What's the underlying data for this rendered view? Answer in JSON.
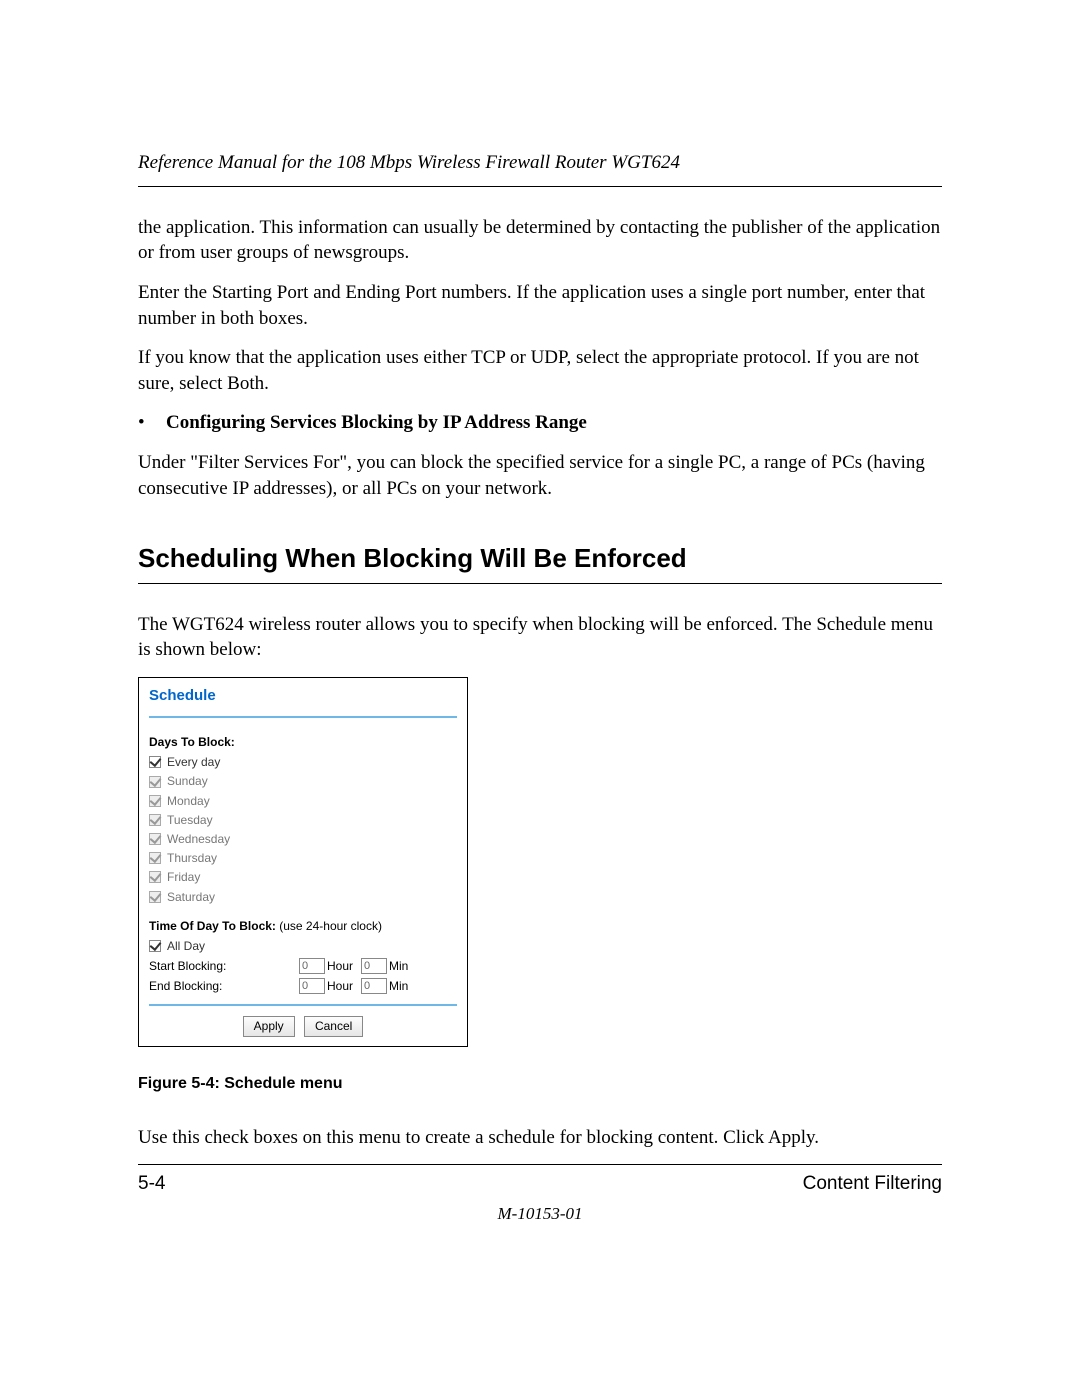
{
  "header": {
    "title": "Reference Manual for the 108 Mbps Wireless Firewall Router WGT624"
  },
  "paragraphs": {
    "p1": "the application. This information can usually be determined by contacting the publisher of the application or from user groups of newsgroups.",
    "p2": "Enter the Starting Port and Ending Port numbers. If the application uses a single port number, enter that number in both boxes.",
    "p3": "If you know that the application uses either TCP or UDP, select the appropriate protocol. If you are not sure, select Both.",
    "bullet_text": "Configuring Services Blocking by IP Address Range",
    "p4": "Under \"Filter Services For\", you can block the specified service for a single PC, a range of PCs (having consecutive IP addresses), or all PCs on your network.",
    "p5": "The WGT624 wireless router allows you to specify when blocking will be enforced. The Schedule menu is shown below:",
    "p6": "Use this check boxes on this menu to create a schedule for blocking content. Click Apply."
  },
  "section_heading": "Scheduling When Blocking Will Be Enforced",
  "schedule": {
    "title": "Schedule",
    "days_label": "Days To Block:",
    "days": [
      {
        "label": "Every day",
        "checked": true,
        "enabled": true
      },
      {
        "label": "Sunday",
        "checked": true,
        "enabled": false
      },
      {
        "label": "Monday",
        "checked": true,
        "enabled": false
      },
      {
        "label": "Tuesday",
        "checked": true,
        "enabled": false
      },
      {
        "label": "Wednesday",
        "checked": true,
        "enabled": false
      },
      {
        "label": "Thursday",
        "checked": true,
        "enabled": false
      },
      {
        "label": "Friday",
        "checked": true,
        "enabled": false
      },
      {
        "label": "Saturday",
        "checked": true,
        "enabled": false
      }
    ],
    "time_label": "Time Of Day To Block:",
    "time_note": " (use 24-hour clock)",
    "all_day_label": "All Day",
    "all_day_checked": true,
    "start_label": "Start Blocking:",
    "end_label": "End Blocking:",
    "hour_unit": "Hour",
    "min_unit": "Min",
    "start_hour": "0",
    "start_min": "0",
    "end_hour": "0",
    "end_min": "0",
    "apply_btn": "Apply",
    "cancel_btn": "Cancel"
  },
  "figure_caption": "Figure 5-4:  Schedule menu",
  "footer": {
    "page_num": "5-4",
    "section_name": "Content Filtering",
    "doc_id": "M-10153-01"
  }
}
